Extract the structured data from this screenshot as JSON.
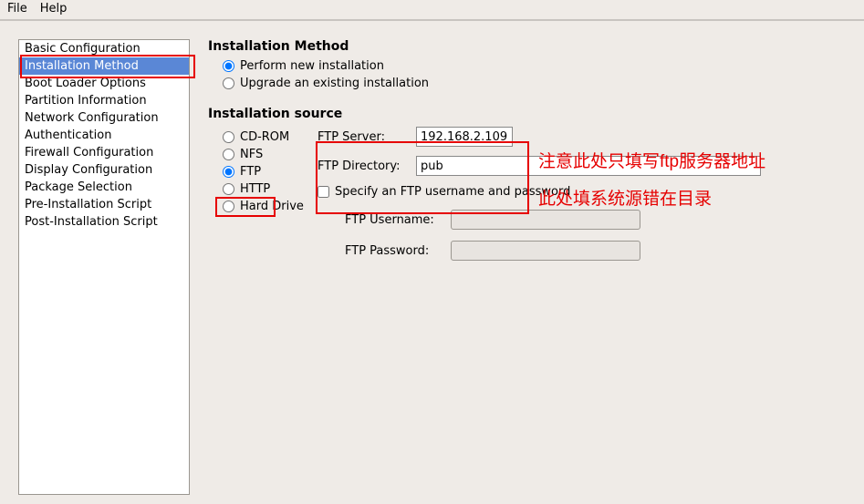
{
  "menu": {
    "file": "File",
    "help": "Help"
  },
  "sidebar": {
    "items": [
      "Basic Configuration",
      "Installation Method",
      "Boot Loader Options",
      "Partition Information",
      "Network Configuration",
      "Authentication",
      "Firewall Configuration",
      "Display Configuration",
      "Package Selection",
      "Pre-Installation Script",
      "Post-Installation Script"
    ],
    "selected_index": 1
  },
  "method": {
    "title": "Installation Method",
    "options": [
      "Perform new installation",
      "Upgrade an existing installation"
    ],
    "selected_index": 0
  },
  "source": {
    "title": "Installation source",
    "options": [
      "CD-ROM",
      "NFS",
      "FTP",
      "HTTP",
      "Hard Drive"
    ],
    "selected_index": 2
  },
  "ftp": {
    "server_label": "FTP Server:",
    "server_value": "192.168.2.109",
    "dir_label": "FTP Directory:",
    "dir_value": "pub",
    "specify_label": "Specify an FTP username and password",
    "specify_checked": false,
    "user_label": "FTP Username:",
    "user_value": "",
    "pass_label": "FTP Password:",
    "pass_value": ""
  },
  "annotations": {
    "note1": "注意此处只填写ftp服务器地址",
    "note2": "此处填系统源错在目录"
  }
}
